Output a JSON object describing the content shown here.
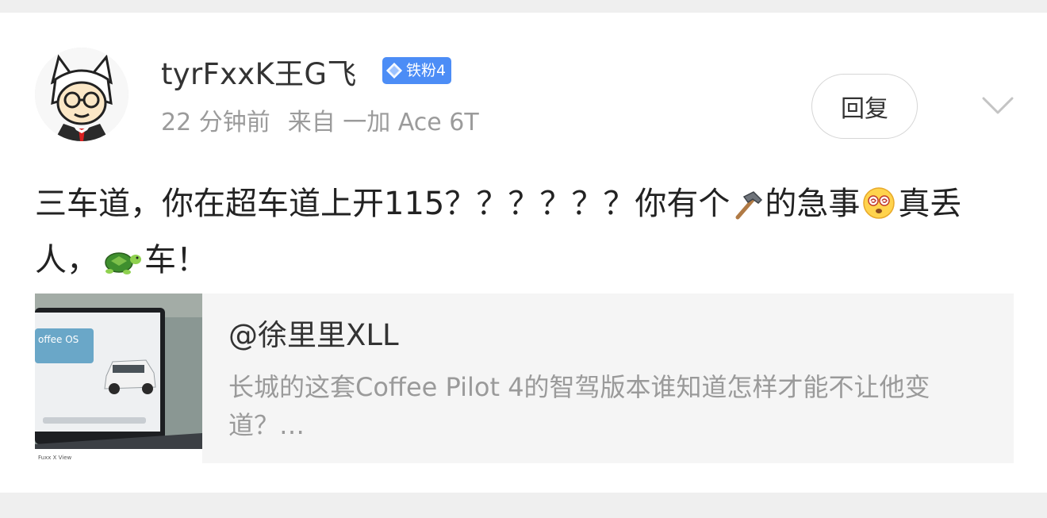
{
  "comment": {
    "username": "tyrFxxK王G飞",
    "badge": {
      "label": "铁粉4",
      "icon": "diamond-icon",
      "color": "#4c8df6"
    },
    "time": "22 分钟前",
    "source": "来自 一加 Ace 6T",
    "reply_label": "回复",
    "more_icon": "chevron-down-icon",
    "content": {
      "part1": "三车道，你在超车道上开115？？？？？？你有个",
      "emoji1": "hammer-emoji",
      "part2": "的急事",
      "emoji2": "dizzy-face-emoji",
      "part3": "真丢人，",
      "emoji3": "turtle-emoji",
      "part4": "车！"
    }
  },
  "quote": {
    "author": "@徐里里XLL",
    "text": "长城的这套Coffee Pilot 4的智驾版本谁知道怎样才能不让他变道？…",
    "thumbnail": {
      "screen_text": "offee OS",
      "footer_text": "Fuxx X View"
    }
  },
  "colors": {
    "page_background": "#efefef",
    "card_background": "#ffffff",
    "quote_background": "#f5f5f5",
    "badge_blue": "#4c8df6",
    "secondary_text": "#9b9b9b"
  }
}
